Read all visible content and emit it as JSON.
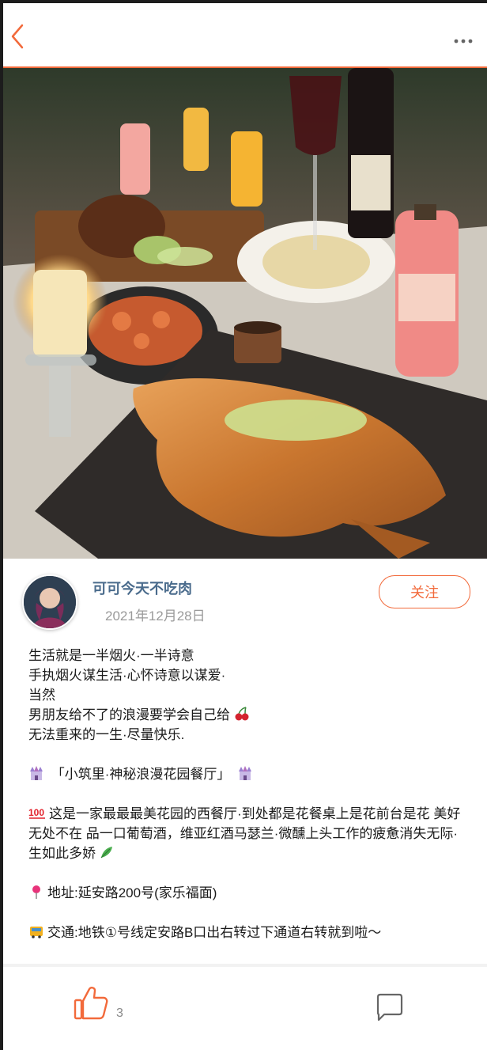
{
  "header": {
    "back_icon": "chevron-left-icon",
    "more_icon": "more-dots-icon",
    "accent_color": "#f26a3b"
  },
  "post": {
    "author_name": "可可今天不吃肉",
    "date": "2021年12月28日",
    "follow_label": "关注",
    "lines": [
      "生活就是一半烟火·一半诗意",
      "手执烟火谋生活·心怀诗意以谋爱·",
      "当然",
      "男朋友给不了的浪漫要学会自己给",
      "无法重来的一生·尽量快乐."
    ],
    "venue": "「小筑里·神秘浪漫花园餐厅」",
    "description": "这是一家最最最美花园的西餐厅·到处都是花餐桌上是花前台是花 美好无处不在 品一口葡萄酒，维亚红酒马瑟兰·微醺上头工作的疲惫消失无际·生如此多娇",
    "address": "地址:延安路200号(家乐福面)",
    "transport": "交通:地铁①号线定安路B口出右转过下通道右转就到啦～"
  },
  "footer": {
    "like_count": "3",
    "like_icon": "thumbs-up-icon",
    "comment_icon": "comment-icon"
  }
}
